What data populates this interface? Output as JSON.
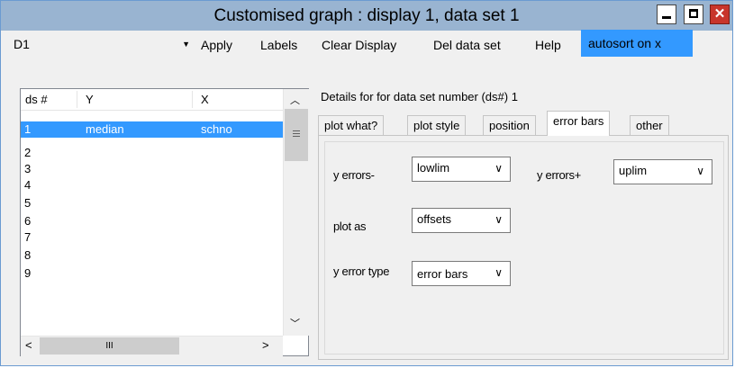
{
  "window": {
    "title": "Customised graph : display 1, data set 1"
  },
  "menubar": {
    "combo_value": "D1",
    "items": [
      "Apply",
      "Labels",
      "Clear Display",
      "Del data set",
      "Help"
    ],
    "autosort": "autosort on x"
  },
  "list": {
    "headers": {
      "ds": "ds #",
      "y": "Y",
      "x": "X"
    },
    "rows": [
      {
        "ds": "1",
        "y": "median",
        "x": "schno"
      },
      {
        "ds": "2",
        "y": "",
        "x": ""
      },
      {
        "ds": "3",
        "y": "",
        "x": ""
      },
      {
        "ds": "4",
        "y": "",
        "x": ""
      },
      {
        "ds": "5",
        "y": "",
        "x": ""
      },
      {
        "ds": "6",
        "y": "",
        "x": ""
      },
      {
        "ds": "7",
        "y": "",
        "x": ""
      },
      {
        "ds": "8",
        "y": "",
        "x": ""
      },
      {
        "ds": "9",
        "y": "",
        "x": ""
      }
    ],
    "hscroll_thumb": "III"
  },
  "details": {
    "label": "Details for for data set number (ds#) 1",
    "tabs": [
      "plot what?",
      "plot style",
      "position",
      "error bars",
      "other"
    ],
    "active_tab": "error bars",
    "fields": {
      "y_errors_minus_label": "y errors-",
      "y_errors_minus_value": "lowlim",
      "y_errors_plus_label": "y errors+",
      "y_errors_plus_value": "uplim",
      "plot_as_label": "plot as",
      "plot_as_value": "offsets",
      "error_type_label": "y error type",
      "error_type_value": "error bars"
    }
  },
  "colors": {
    "titlebar": "#99b4d1",
    "selection": "#3399ff",
    "close": "#c8352b"
  }
}
